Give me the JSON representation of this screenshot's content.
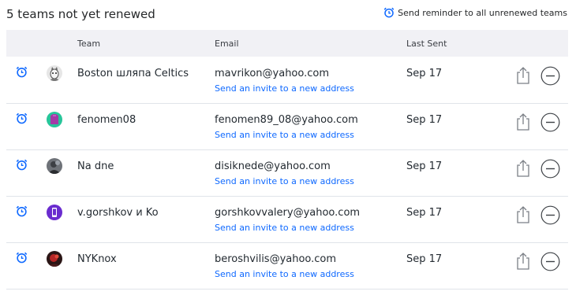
{
  "heading": "5 teams not yet renewed",
  "reminder_link": "Send reminder to all unrenewed teams",
  "columns": {
    "team": "Team",
    "email": "Email",
    "last_sent": "Last Sent"
  },
  "rows": [
    {
      "team": "Boston шляпа Celtics",
      "email": "mavrikon@yahoo.com",
      "invite": "Send an invite to a new address",
      "last_sent": "Sep 17",
      "avatar": "gray-cat"
    },
    {
      "team": "fenomen08",
      "email": "fenomen89_08@yahoo.com",
      "invite": "Send an invite to a new address",
      "last_sent": "Sep 17",
      "avatar": "teal-purple-jersey"
    },
    {
      "team": "Na dne",
      "email": "disiknede@yahoo.com",
      "invite": "Send an invite to a new address",
      "last_sent": "Sep 17",
      "avatar": "dark-photo"
    },
    {
      "team": "v.gorshkov и Ko",
      "email": "gorshkovvalery@yahoo.com",
      "invite": "Send an invite to a new address",
      "last_sent": "Sep 17",
      "avatar": "purple-phone"
    },
    {
      "team": "NYKnox",
      "email": "beroshvilis@yahoo.com",
      "invite": "Send an invite to a new address",
      "last_sent": "Sep 17",
      "avatar": "red-dark-photo"
    }
  ],
  "colors": {
    "accent": "#0f69ff",
    "header_bg": "#f1f1f5",
    "divider": "#e0e4e9"
  },
  "icons": {
    "reminder": "alarm-clock-icon",
    "share": "share-icon",
    "remove": "minus-circle-icon"
  }
}
